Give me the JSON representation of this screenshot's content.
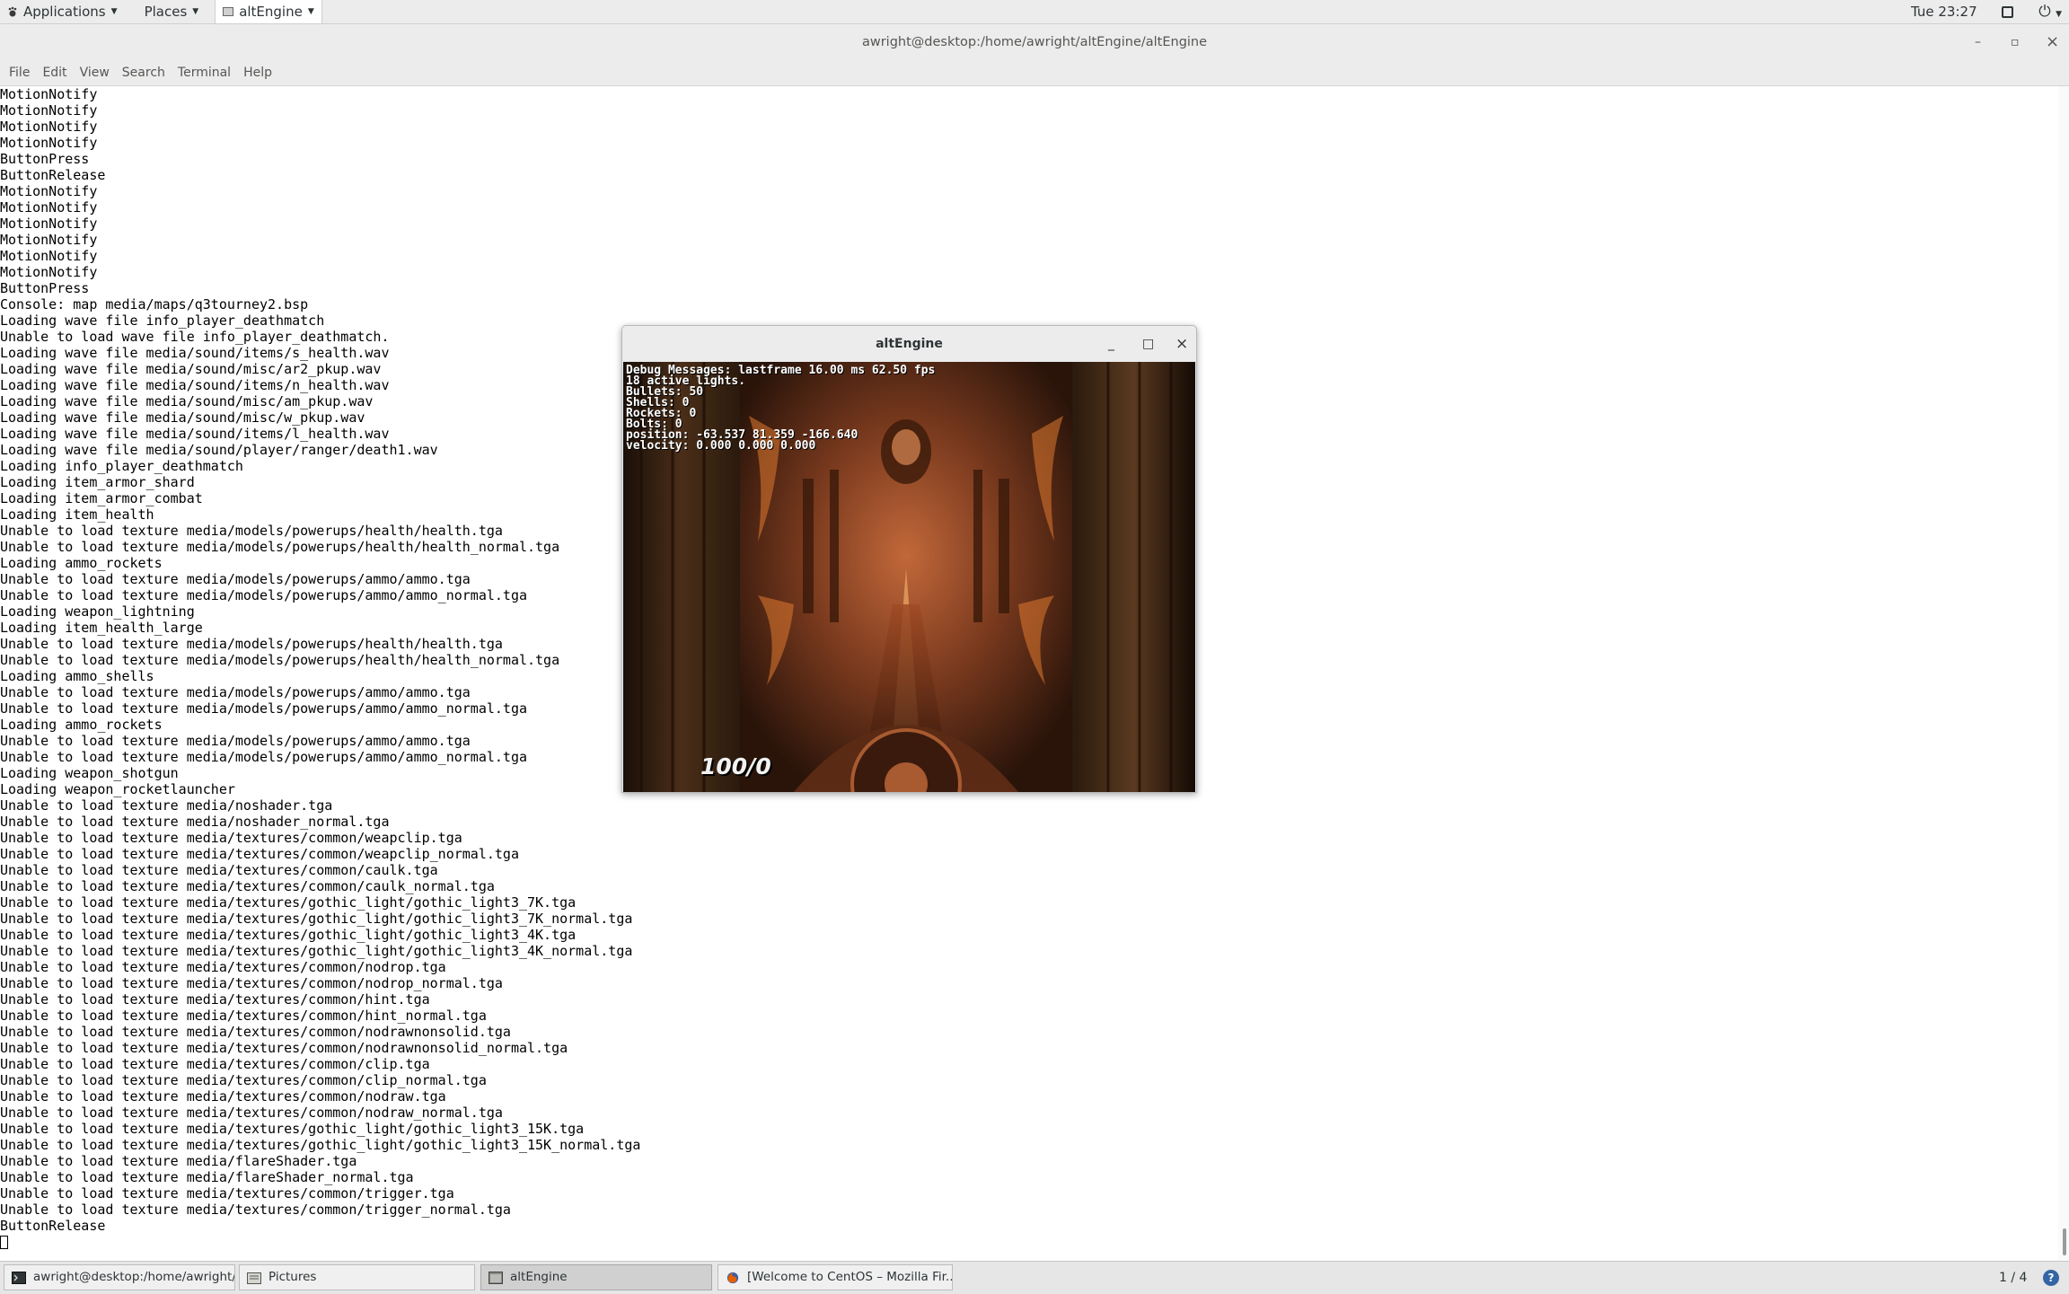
{
  "topbar": {
    "applications": "Applications",
    "places": "Places",
    "active_app": "altEngine",
    "clock": "Tue 23:27"
  },
  "terminal": {
    "title": "awright@desktop:/home/awright/altEngine/altEngine",
    "controls": {
      "minimize": "–",
      "maximize": "▫",
      "close": "×"
    },
    "menu": [
      "File",
      "Edit",
      "View",
      "Search",
      "Terminal",
      "Help"
    ],
    "lines": [
      "MotionNotify",
      "MotionNotify",
      "MotionNotify",
      "MotionNotify",
      "ButtonPress",
      "ButtonRelease",
      "MotionNotify",
      "MotionNotify",
      "MotionNotify",
      "MotionNotify",
      "MotionNotify",
      "MotionNotify",
      "ButtonPress",
      "Console: map media/maps/q3tourney2.bsp",
      "Loading wave file info_player_deathmatch",
      "Unable to load wave file info_player_deathmatch.",
      "Loading wave file media/sound/items/s_health.wav",
      "Loading wave file media/sound/misc/ar2_pkup.wav",
      "Loading wave file media/sound/items/n_health.wav",
      "Loading wave file media/sound/misc/am_pkup.wav",
      "Loading wave file media/sound/misc/w_pkup.wav",
      "Loading wave file media/sound/items/l_health.wav",
      "Loading wave file media/sound/player/ranger/death1.wav",
      "Loading info_player_deathmatch",
      "Loading item_armor_shard",
      "Loading item_armor_combat",
      "Loading item_health",
      "Unable to load texture media/models/powerups/health/health.tga",
      "Unable to load texture media/models/powerups/health/health_normal.tga",
      "Loading ammo_rockets",
      "Unable to load texture media/models/powerups/ammo/ammo.tga",
      "Unable to load texture media/models/powerups/ammo/ammo_normal.tga",
      "Loading weapon_lightning",
      "Loading item_health_large",
      "Unable to load texture media/models/powerups/health/health.tga",
      "Unable to load texture media/models/powerups/health/health_normal.tga",
      "Loading ammo_shells",
      "Unable to load texture media/models/powerups/ammo/ammo.tga",
      "Unable to load texture media/models/powerups/ammo/ammo_normal.tga",
      "Loading ammo_rockets",
      "Unable to load texture media/models/powerups/ammo/ammo.tga",
      "Unable to load texture media/models/powerups/ammo/ammo_normal.tga",
      "Loading weapon_shotgun",
      "Loading weapon_rocketlauncher",
      "Unable to load texture media/noshader.tga",
      "Unable to load texture media/noshader_normal.tga",
      "Unable to load texture media/textures/common/weapclip.tga",
      "Unable to load texture media/textures/common/weapclip_normal.tga",
      "Unable to load texture media/textures/common/caulk.tga",
      "Unable to load texture media/textures/common/caulk_normal.tga",
      "Unable to load texture media/textures/gothic_light/gothic_light3_7K.tga",
      "Unable to load texture media/textures/gothic_light/gothic_light3_7K_normal.tga",
      "Unable to load texture media/textures/gothic_light/gothic_light3_4K.tga",
      "Unable to load texture media/textures/gothic_light/gothic_light3_4K_normal.tga",
      "Unable to load texture media/textures/common/nodrop.tga",
      "Unable to load texture media/textures/common/nodrop_normal.tga",
      "Unable to load texture media/textures/common/hint.tga",
      "Unable to load texture media/textures/common/hint_normal.tga",
      "Unable to load texture media/textures/common/nodrawnonsolid.tga",
      "Unable to load texture media/textures/common/nodrawnonsolid_normal.tga",
      "Unable to load texture media/textures/common/clip.tga",
      "Unable to load texture media/textures/common/clip_normal.tga",
      "Unable to load texture media/textures/common/nodraw.tga",
      "Unable to load texture media/textures/common/nodraw_normal.tga",
      "Unable to load texture media/textures/gothic_light/gothic_light3_15K.tga",
      "Unable to load texture media/textures/gothic_light/gothic_light3_15K_normal.tga",
      "Unable to load texture media/flareShader.tga",
      "Unable to load texture media/flareShader_normal.tga",
      "Unable to load texture media/textures/common/trigger.tga",
      "Unable to load texture media/textures/common/trigger_normal.tga",
      "ButtonRelease"
    ]
  },
  "game": {
    "title": "altEngine",
    "controls": {
      "minimize": "_",
      "maximize": "□",
      "close": "×"
    },
    "hud": [
      "Debug Messages: lastframe 16.00 ms 62.50 fps",
      "18 active lights.",
      "Bullets: 50",
      "Shells: 0",
      "Rockets: 0",
      "Bolts: 0",
      "position: -63.537 81.359 -166.640",
      "velocity: 0.000 0.000 0.000"
    ],
    "health_armor": "100/0"
  },
  "taskbar": {
    "tasks": [
      {
        "label": "awright@desktop:/home/awright/...",
        "icon": "terminal-icon"
      },
      {
        "label": "Pictures",
        "icon": "folder-icon"
      },
      {
        "label": "altEngine",
        "icon": "window-icon"
      },
      {
        "label": "[Welcome to CentOS – Mozilla Fir...",
        "icon": "firefox-icon"
      }
    ],
    "workspace": "1 / 4"
  },
  "colors": {
    "panel_bg": "#ececec",
    "terminal_bg": "#ffffff",
    "terminal_fg": "#000000",
    "taskbar_bg": "#e6e6e6"
  }
}
